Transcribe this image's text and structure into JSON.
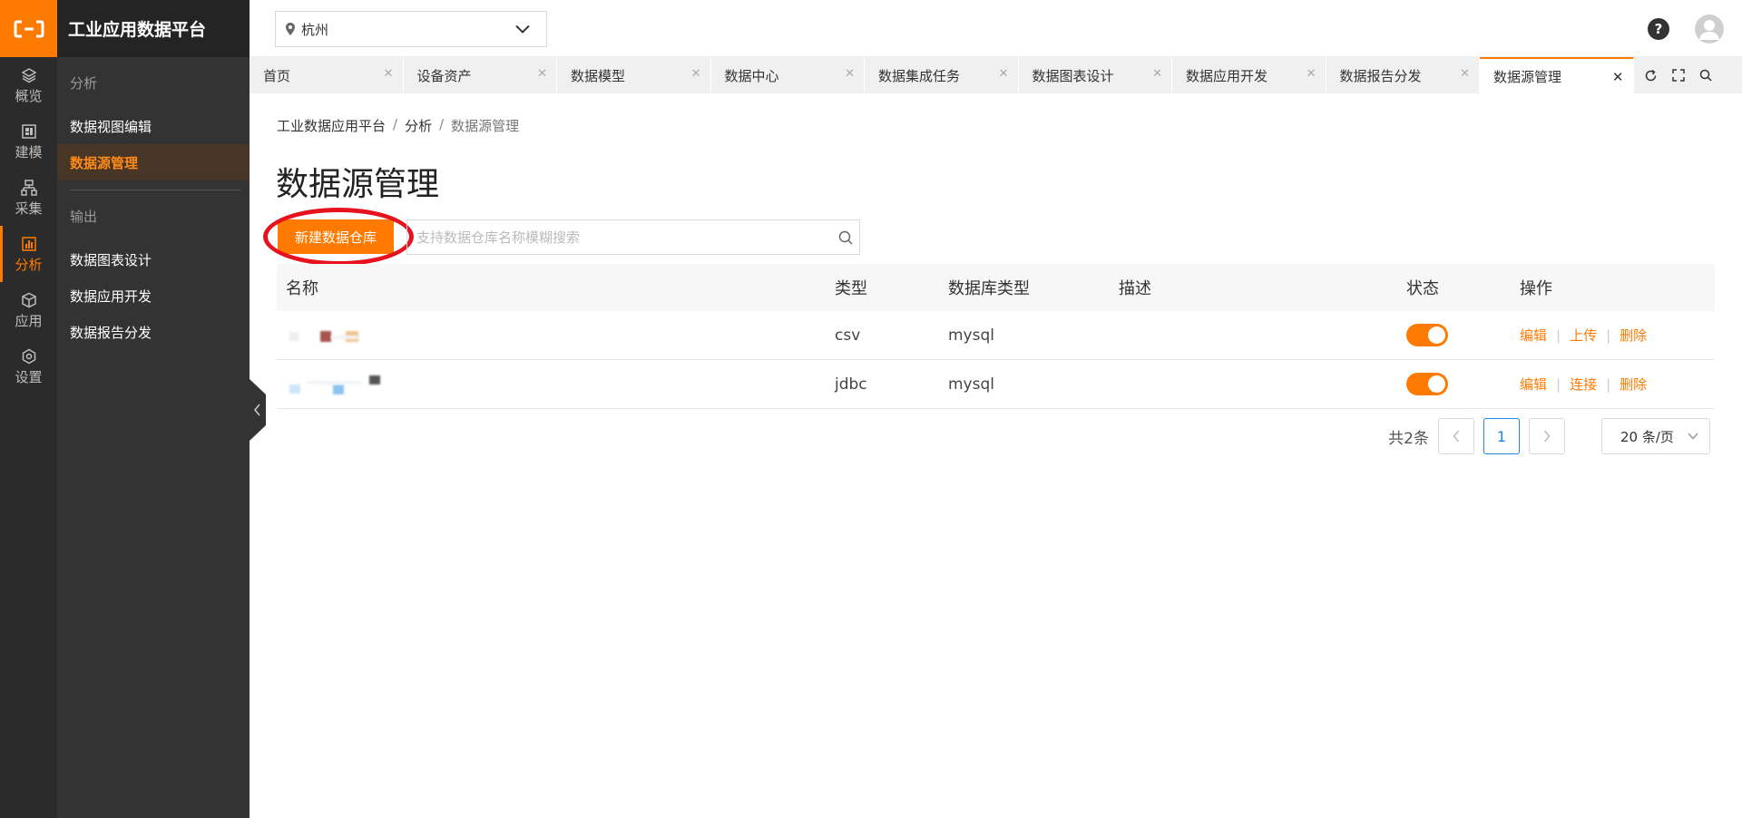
{
  "app": {
    "title": "工业应用数据平台"
  },
  "rail": {
    "items": [
      {
        "label": "概览",
        "icon": "layers-icon"
      },
      {
        "label": "建模",
        "icon": "model-icon"
      },
      {
        "label": "采集",
        "icon": "collect-icon"
      },
      {
        "label": "分析",
        "icon": "chart-icon",
        "active": true
      },
      {
        "label": "应用",
        "icon": "cube-icon"
      },
      {
        "label": "设置",
        "icon": "settings-icon"
      }
    ]
  },
  "sidebar": {
    "group1": "分析",
    "items1": [
      "数据视图编辑",
      "数据源管理"
    ],
    "group2": "输出",
    "items2": [
      "数据图表设计",
      "数据应用开发",
      "数据报告分发"
    ]
  },
  "header": {
    "city": "杭州",
    "help": "?"
  },
  "tabs": [
    "首页",
    "设备资产",
    "数据模型",
    "数据中心",
    "数据集成任务",
    "数据图表设计",
    "数据应用开发",
    "数据报告分发",
    "数据源管理"
  ],
  "breadcrumb": [
    "工业数据应用平台",
    "分析",
    "数据源管理"
  ],
  "breadcrumb_sep": "/",
  "page": {
    "title": "数据源管理",
    "new_button": "新建数据仓库",
    "search_placeholder": "支持数据仓库名称模糊搜索"
  },
  "table": {
    "headers": [
      "名称",
      "类型",
      "数据库类型",
      "描述",
      "状态",
      "操作"
    ],
    "rows": [
      {
        "type": "csv",
        "db_type": "mysql",
        "desc": "",
        "enabled": true,
        "ops": [
          "编辑",
          "上传",
          "删除"
        ]
      },
      {
        "type": "jdbc",
        "db_type": "mysql",
        "desc": "",
        "enabled": true,
        "ops": [
          "编辑",
          "连接",
          "删除"
        ]
      }
    ]
  },
  "pagination": {
    "total": "共2条",
    "current": "1",
    "page_size": "20 条/页"
  },
  "colors": {
    "accent": "#ff7a00",
    "highlight": "#e8121e",
    "pager_active": "#1e88e5"
  }
}
